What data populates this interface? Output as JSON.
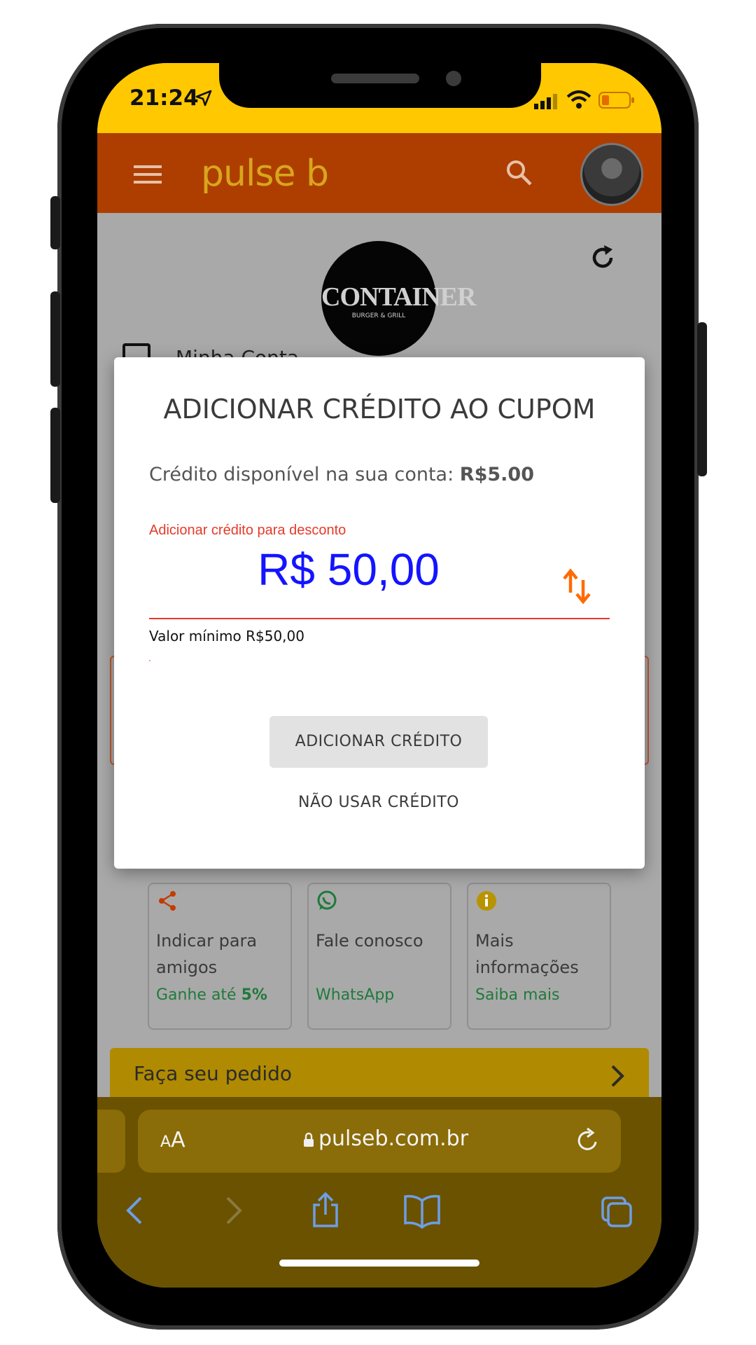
{
  "status": {
    "time": "21:24"
  },
  "app": {
    "logo_text": "pulse b"
  },
  "brand": {
    "name": "CONTAINER",
    "sub": "BURGER & GRILL"
  },
  "account": {
    "label": "Minha Conta"
  },
  "modal": {
    "title": "ADICIONAR CRÉDITO AO CUPOM",
    "credit_prefix": "Crédito disponível na sua conta: ",
    "credit_value": "R$5.00",
    "field_label": "Adicionar crédito para desconto",
    "amount": "R$ 50,00",
    "hint": "Valor mínimo R$50,00",
    "add_button": "ADICIONAR CRÉDITO",
    "skip_button": "NÃO USAR CRÉDITO"
  },
  "tiles": [
    {
      "title": "Indicar para amigos",
      "sub_prefix": "Ganhe até ",
      "sub_bold": "5%",
      "icon": "share-icon"
    },
    {
      "title": "Fale conosco",
      "sub_prefix": "WhatsApp",
      "sub_bold": "",
      "icon": "whatsapp-icon"
    },
    {
      "title": "Mais informações",
      "sub_prefix": "Saiba mais",
      "sub_bold": "",
      "icon": "info-icon"
    }
  ],
  "order": {
    "label": "Faça seu pedido"
  },
  "browser": {
    "aa_small": "A",
    "aa_big": "A",
    "url": "pulseb.com.br"
  },
  "colors": {
    "accent": "#ad3e00",
    "status": "#ffc800",
    "amount": "#1414ff",
    "error": "#e53a2a",
    "positive": "#1f7a3a"
  }
}
